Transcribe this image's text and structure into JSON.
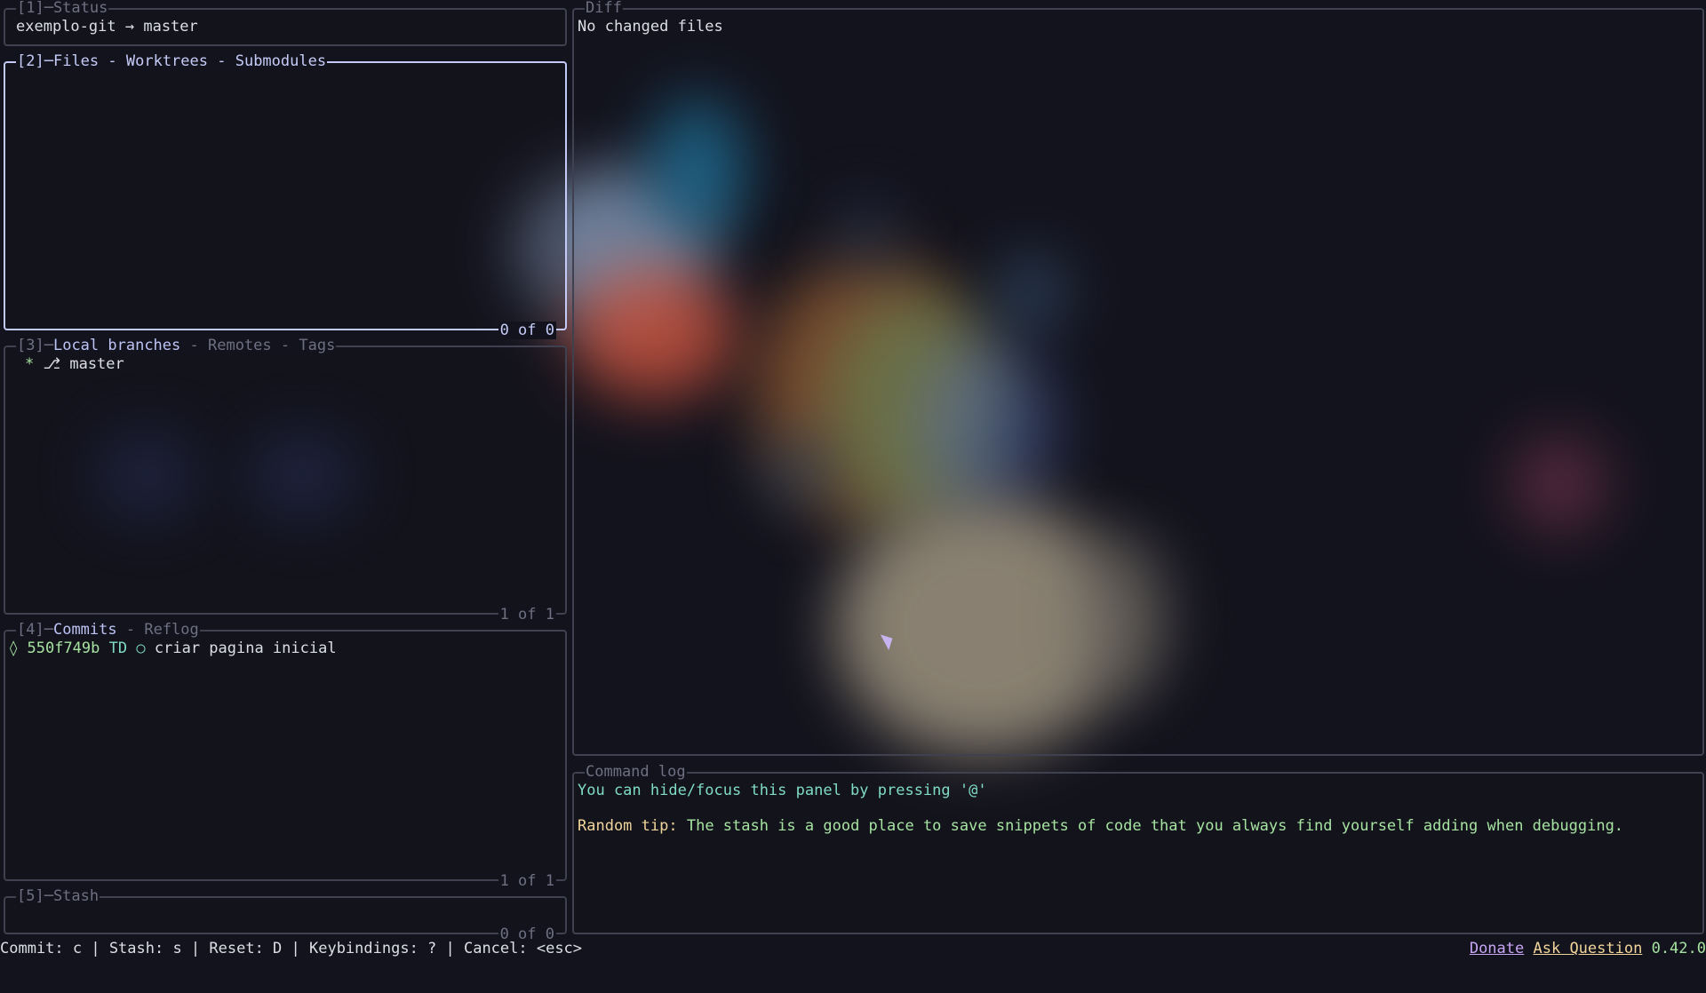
{
  "panels": {
    "status": {
      "title": "[1]─Status",
      "repo": "exemplo-git",
      "arrow": "→",
      "branch": "master"
    },
    "files": {
      "num": "[2]",
      "title": "Files",
      "tab2": "Worktrees",
      "tab3": "Submodules",
      "footer": "0 of 0"
    },
    "branches": {
      "num": "[3]",
      "title": "Local branches",
      "tab2": "Remotes",
      "tab3": "Tags",
      "footer": "1 of 1",
      "items": [
        {
          "marker": "*",
          "icon": "⎇",
          "name": "master"
        }
      ]
    },
    "commits": {
      "num": "[4]",
      "title": "Commits",
      "tab2": "Reflog",
      "footer": "1 of 1",
      "items": [
        {
          "graph": "◊",
          "hash": "550f749b",
          "author": "TD",
          "node": "○",
          "message": "criar pagina inicial"
        }
      ]
    },
    "stash": {
      "title": "[5]─Stash",
      "footer": "0 of 0"
    },
    "diff": {
      "title": "Diff",
      "text": "No changed files"
    },
    "command_log": {
      "title": "Command log",
      "line1": "You can hide/focus this panel by pressing '@'",
      "tip_label": "Random tip:",
      "tip_text": "The stash is a good place to save snippets of code that you always find yourself adding when debugging."
    }
  },
  "bottom_bar": {
    "keybindings": "Commit: c | Stash: s | Reset: D | Keybindings: ? | Cancel: <esc>",
    "donate": "Donate",
    "ask_question": "Ask Question",
    "version": "0.42.0"
  },
  "icons": [
    "branch-icon",
    "commit-graph-icon",
    "commit-node-icon",
    "mouse-pointer-icon"
  ],
  "colors": {
    "background": "#13131d",
    "focused_border": "#c5c9f7",
    "border": "#3f4150",
    "hash": "#a6e3a1",
    "author": "#7fdbc6"
  }
}
